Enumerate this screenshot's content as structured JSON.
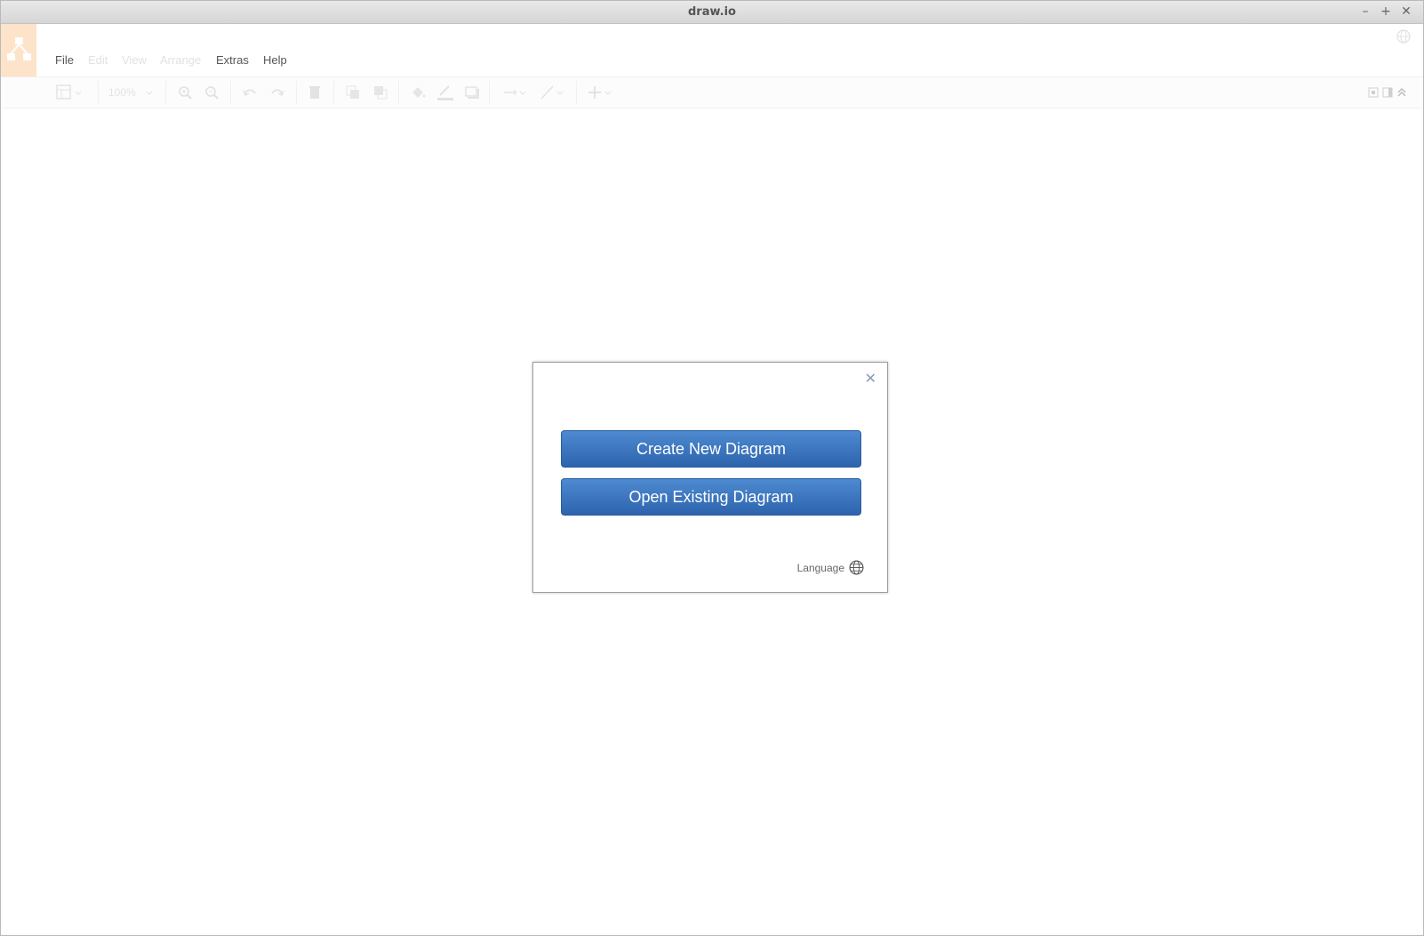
{
  "window": {
    "title": "draw.io",
    "controls": {
      "minimize": "–",
      "maximize": "+",
      "close": "✕"
    }
  },
  "menu": {
    "file": "File",
    "edit": "Edit",
    "view": "View",
    "arrange": "Arrange",
    "extras": "Extras",
    "help": "Help"
  },
  "toolbar": {
    "zoom": "100%",
    "icons": [
      "format-panel-icon",
      "zoom-in-icon",
      "zoom-out-icon",
      "undo-icon",
      "redo-icon",
      "delete-icon",
      "to-front-icon",
      "to-back-icon",
      "fill-color-icon",
      "line-color-icon",
      "shadow-icon",
      "connection-icon",
      "waypoints-icon",
      "insert-icon",
      "fullscreen-icon",
      "sidebar-toggle-icon",
      "collapse-icon"
    ]
  },
  "dialog": {
    "close": "✕",
    "create_label": "Create New Diagram",
    "open_label": "Open Existing Diagram",
    "language_label": "Language"
  },
  "colors": {
    "button": "#3a73c0",
    "logo_bg": "#fde3c9"
  }
}
